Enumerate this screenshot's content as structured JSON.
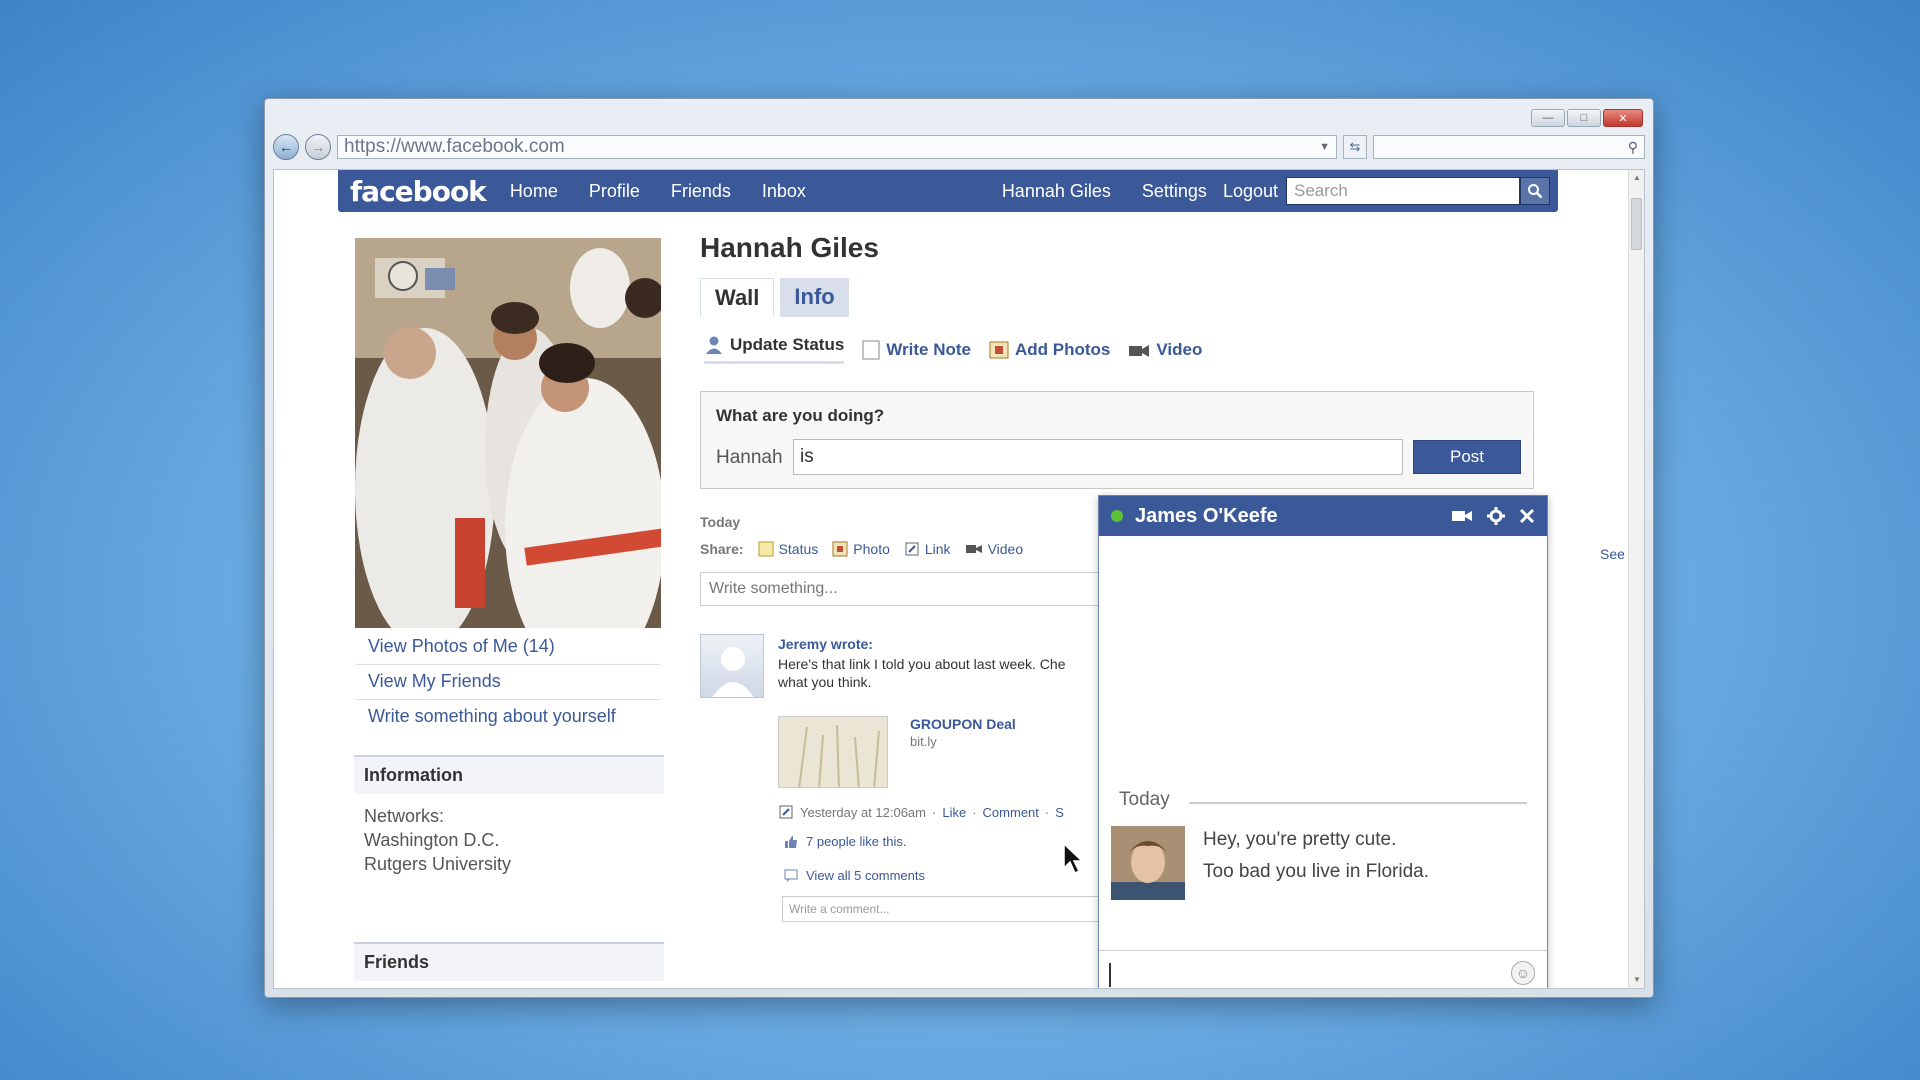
{
  "browser": {
    "url": "https://www.facebook.com"
  },
  "fb": {
    "logo": "facebook",
    "nav": [
      "Home",
      "Profile",
      "Friends",
      "Inbox"
    ],
    "user": "Hannah Giles",
    "settings": "Settings",
    "logout": "Logout",
    "search_placeholder": "Search"
  },
  "profile": {
    "name": "Hannah Giles",
    "tabs": {
      "wall": "Wall",
      "info": "Info"
    },
    "actions": {
      "update_status": "Update Status",
      "write_note": "Write Note",
      "add_photos": "Add Photos",
      "video": "Video"
    },
    "left_links": [
      "View Photos of Me (14)",
      "View My Friends",
      "Write something about yourself"
    ],
    "information_title": "Information",
    "networks_label": "Networks:",
    "networks": [
      "Washington D.C.",
      "Rutgers University"
    ],
    "friends_title": "Friends"
  },
  "status": {
    "question": "What are you doing?",
    "name": "Hannah",
    "value": "is",
    "post_label": "Post"
  },
  "wall": {
    "today": "Today",
    "share_label": "Share:",
    "share_items": {
      "status": "Status",
      "photo": "Photo",
      "link": "Link",
      "video": "Video"
    },
    "write_placeholder": "Write something...",
    "see": "See",
    "post": {
      "author": "Jeremy wrote:",
      "text_line1": "Here's that link I told you about last week.  Che",
      "text_line2": "what you think.",
      "link_title": "GROUPON Deal",
      "link_source": "bit.ly",
      "timestamp": "Yesterday at 12:06am",
      "like": "Like",
      "comment": "Comment",
      "share_trunc": "S",
      "likes_text": "7 people like this.",
      "view_comments": "View all 5 comments",
      "comment_placeholder": "Write a comment..."
    }
  },
  "chat": {
    "name": "James O'Keefe",
    "today": "Today",
    "message_line1": "Hey, you're pretty cute.",
    "message_line2": "Too bad you live in Florida."
  },
  "colors": {
    "fb_blue": "#3b5998",
    "link": "#3b5998",
    "online": "#5bc236"
  }
}
